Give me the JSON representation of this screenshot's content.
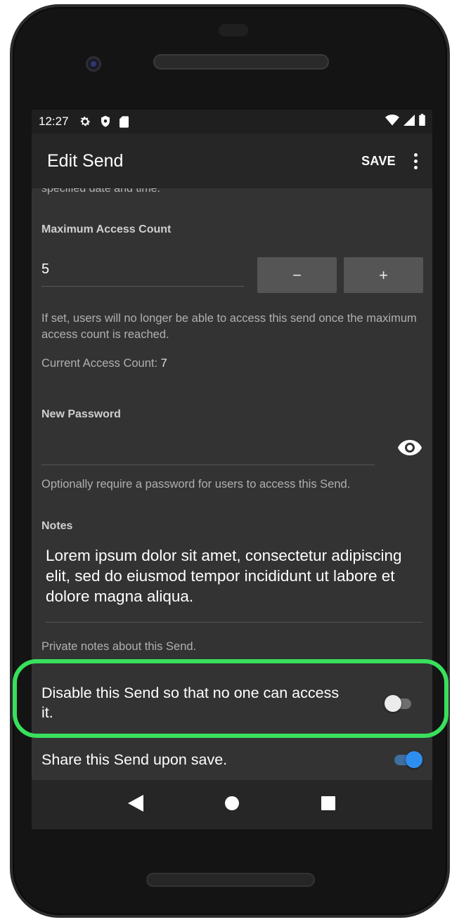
{
  "statusbar": {
    "time": "12:27",
    "icons": [
      "gear-icon",
      "shield-icon",
      "sd-card-icon"
    ],
    "right_icons": [
      "wifi-icon",
      "signal-icon",
      "battery-icon"
    ]
  },
  "appbar": {
    "title": "Edit Send",
    "save_label": "SAVE",
    "more_icon": "more-vert-icon"
  },
  "form": {
    "cut_help": "specified date and time.",
    "max_access": {
      "label": "Maximum Access Count",
      "value": "5",
      "decrement": "−",
      "increment": "+",
      "help": "If set, users will no longer be able to access this send once the maximum access count is reached.",
      "current_label": "Current Access Count:",
      "current_value": "7"
    },
    "password": {
      "label": "New Password",
      "value": "",
      "toggle_icon": "eye-icon",
      "help": "Optionally require a password for users to access this Send."
    },
    "notes": {
      "label": "Notes",
      "value": "Lorem ipsum dolor sit amet, consectetur adipiscing elit, sed do eiusmod tempor incididunt ut labore et dolore magna aliqua.",
      "help": "Private notes about this Send."
    },
    "disable": {
      "label": "Disable this Send so that no one can access it.",
      "checked": false
    },
    "share": {
      "label": "Share this Send upon save.",
      "checked": true
    }
  },
  "colors": {
    "highlight": "#38e05c",
    "accent": "#2e8ef0",
    "background": "#333333"
  },
  "navbar": {
    "icons": [
      "back-icon",
      "home-icon",
      "recents-icon"
    ]
  }
}
